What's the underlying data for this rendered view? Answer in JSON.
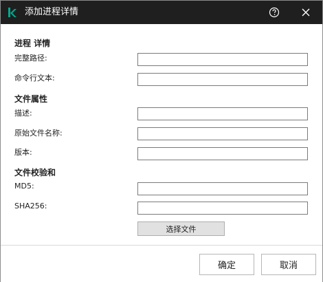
{
  "window": {
    "title": "添加进程详情",
    "logo_icon": "kaspersky-k-logo",
    "accent_color": "#00a88e",
    "titlebar_color": "#1f1f1f"
  },
  "sections": {
    "process": {
      "heading": "进程 详情",
      "full_path_label": "完整路径:",
      "full_path_value": "",
      "cmdline_label": "命令行文本:",
      "cmdline_value": ""
    },
    "file_attrs": {
      "heading": "文件属性",
      "description_label": "描述:",
      "description_value": "",
      "original_name_label": "原始文件名称:",
      "original_name_value": "",
      "version_label": "版本:",
      "version_value": ""
    },
    "checksum": {
      "heading": "文件校验和",
      "md5_label": "MD5:",
      "md5_value": "",
      "sha256_label": "SHA256:",
      "sha256_value": "",
      "select_file_label": "选择文件"
    }
  },
  "footer": {
    "ok_label": "确定",
    "cancel_label": "取消"
  }
}
